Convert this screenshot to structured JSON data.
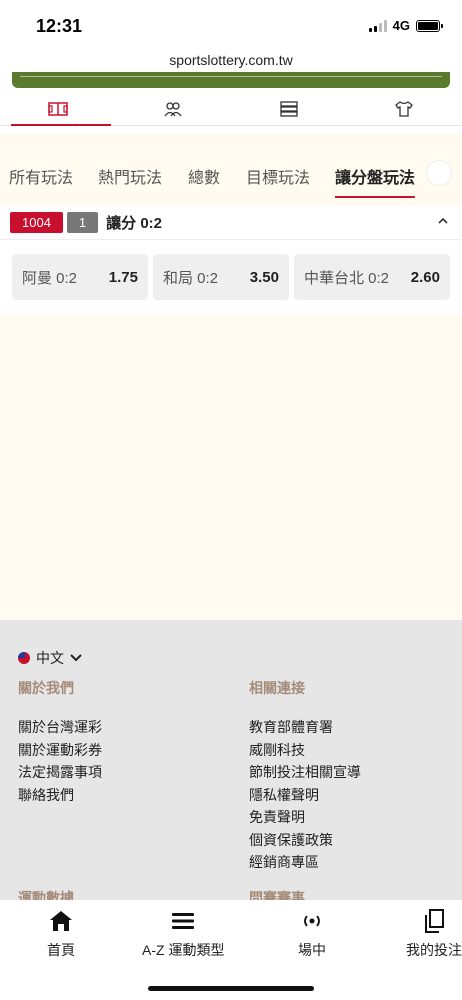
{
  "status_bar": {
    "time": "12:31",
    "network": "4G"
  },
  "browser": {
    "url": "sportslottery.com.tw"
  },
  "icon_tabs": [
    {
      "icon": "field-icon",
      "active": true
    },
    {
      "icon": "players-icon",
      "active": false
    },
    {
      "icon": "list-icon",
      "active": false
    },
    {
      "icon": "jersey-icon",
      "active": false
    }
  ],
  "bet_tabs": [
    {
      "label": "所有玩法",
      "active": false
    },
    {
      "label": "熱門玩法",
      "active": false
    },
    {
      "label": "總數",
      "active": false
    },
    {
      "label": "目標玩法",
      "active": false
    },
    {
      "label": "讓分盤玩法",
      "active": true
    }
  ],
  "market": {
    "code": "1004",
    "number": "1",
    "title": "讓分 0:2",
    "odds": [
      {
        "label": "阿曼 0:2",
        "value": "1.75"
      },
      {
        "label": "和局 0:2",
        "value": "3.50"
      },
      {
        "label": "中華台北 0:2",
        "value": "2.60"
      }
    ]
  },
  "footer": {
    "language": "中文",
    "about_heading": "關於我們",
    "about_links": [
      "關於台灣運彩",
      "關於運動彩券",
      "法定揭露事項",
      "聯絡我們"
    ],
    "related_heading": "相關連接",
    "related_links": [
      "教育部體育署",
      "威剛科技",
      "節制投注相關宣導",
      "隱私權聲明",
      "免責聲明",
      "個資保護政策",
      "經銷商專區"
    ],
    "sports_heading": "運動數據",
    "popular_heading": "問賽賽事"
  },
  "bottom_nav": [
    {
      "label": "首頁",
      "icon": "home-icon"
    },
    {
      "label": "A-Z 運動類型",
      "icon": "menu-icon"
    },
    {
      "label": "場中",
      "icon": "live-icon"
    },
    {
      "label": "我的投注",
      "icon": "copy-icon"
    }
  ],
  "colors": {
    "accent": "#c8102e",
    "cream_bg": "#fffbf0",
    "footer_bg": "#e6e6e6",
    "footer_heading": "#a58c7a"
  }
}
